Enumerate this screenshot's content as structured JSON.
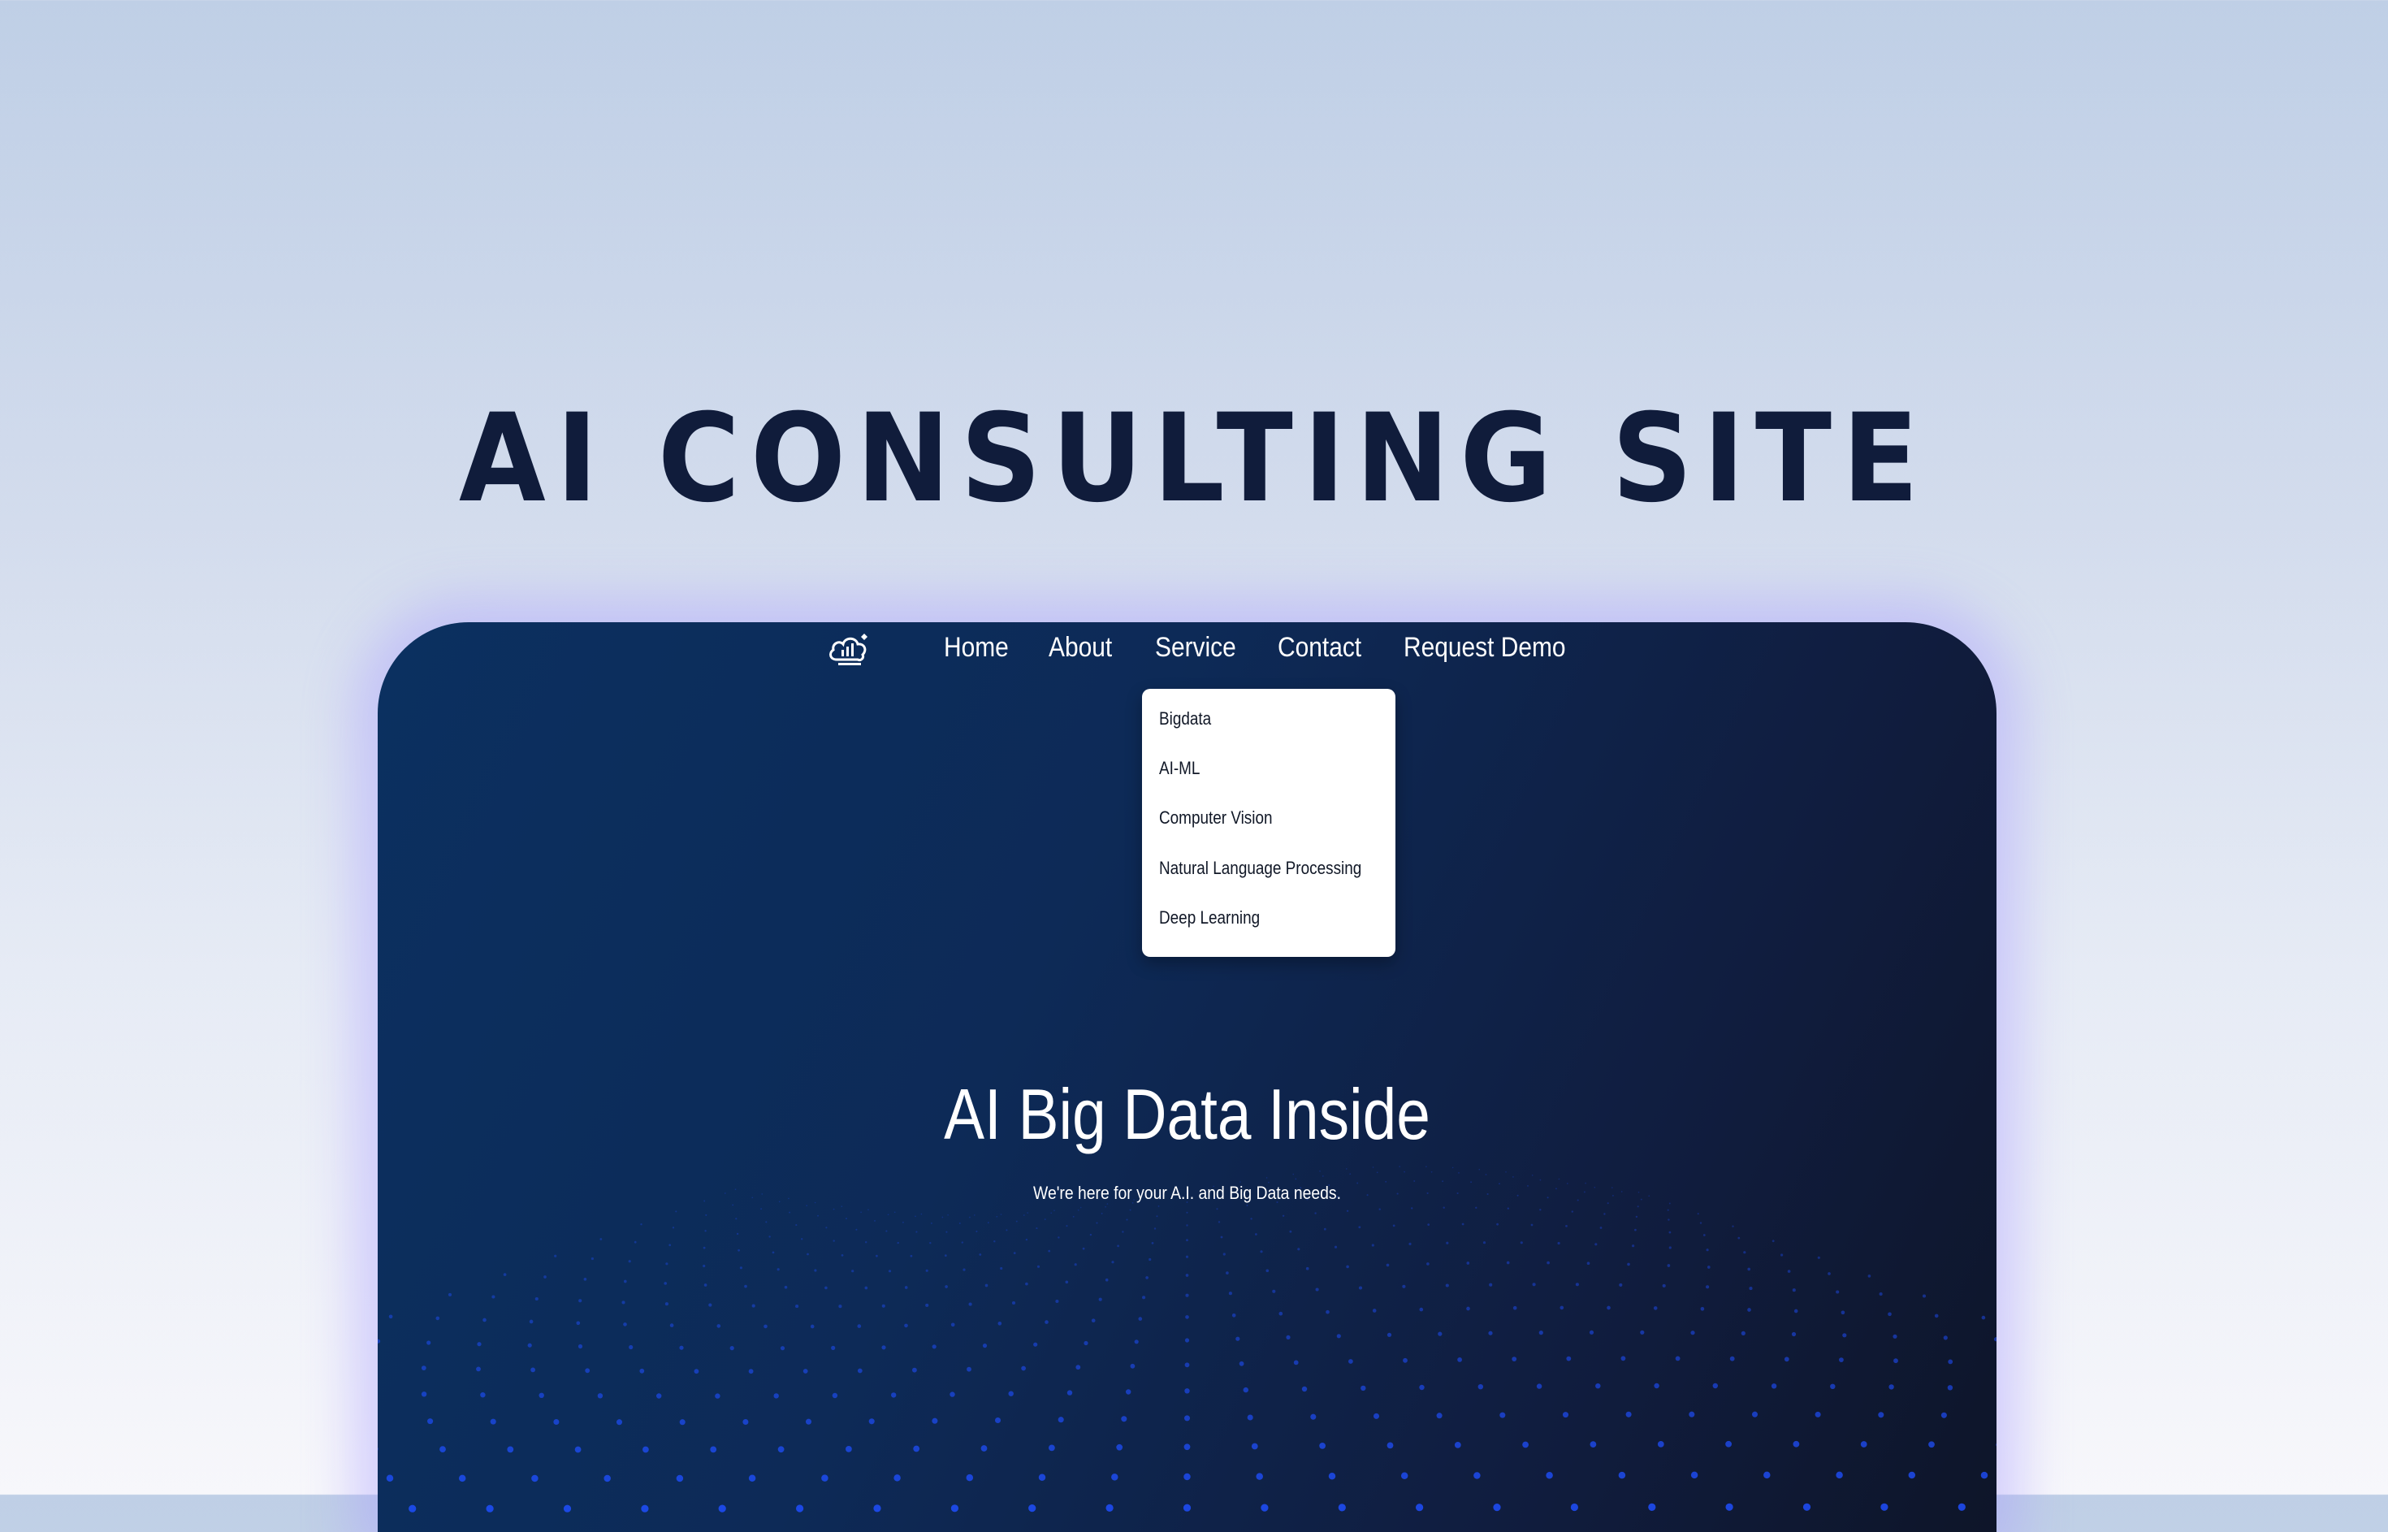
{
  "page": {
    "heading": "AI CONSULTING SITE"
  },
  "navbar": {
    "logo_icon": "cloud-analytics-logo-icon",
    "items": [
      {
        "label": "Home"
      },
      {
        "label": "About"
      },
      {
        "label": "Service"
      },
      {
        "label": "Contact"
      },
      {
        "label": "Request Demo"
      }
    ]
  },
  "service_dropdown": {
    "items": [
      {
        "label": "Bigdata"
      },
      {
        "label": "AI-ML"
      },
      {
        "label": "Computer Vision"
      },
      {
        "label": "Natural Language Processing"
      },
      {
        "label": "Deep Learning"
      }
    ]
  },
  "hero": {
    "title": "AI Big Data Inside",
    "subtitle": "We're here for your A.I. and Big Data needs."
  },
  "colors": {
    "heading": "#101c3b",
    "hero_bg_start": "#0b3060",
    "hero_bg_end": "#0e1529",
    "dot_accent": "#1f4fff",
    "glow": "#aaa0ff"
  }
}
